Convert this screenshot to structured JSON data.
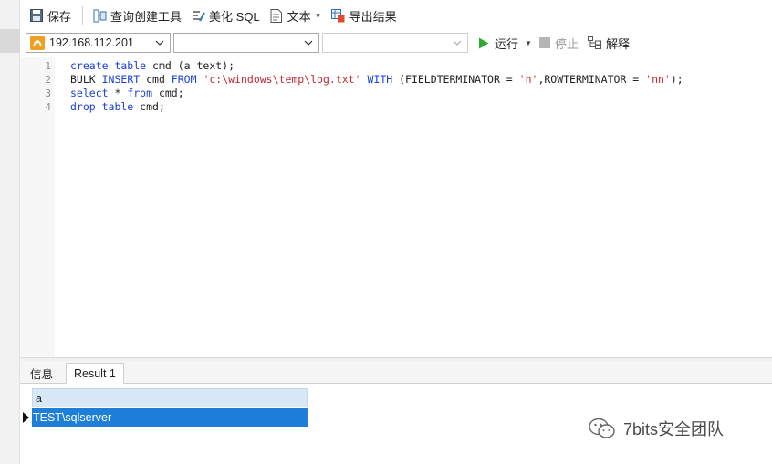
{
  "toolbar": {
    "save": "保存",
    "query_builder": "查询创建工具",
    "beautify_sql": "美化 SQL",
    "text": "文本",
    "export": "导出结果"
  },
  "connection": {
    "server": "192.168.112.201",
    "database": "",
    "schema": "",
    "run": "运行",
    "stop": "停止",
    "explain": "解释"
  },
  "editor": {
    "line_numbers": [
      "1",
      "2",
      "3",
      "4"
    ],
    "lines": [
      [
        {
          "t": "create table",
          "c": "kw"
        },
        {
          "t": " cmd (a text);",
          "c": ""
        }
      ],
      [
        {
          "t": "BULK ",
          "c": ""
        },
        {
          "t": "INSERT",
          "c": "kw"
        },
        {
          "t": " cmd ",
          "c": ""
        },
        {
          "t": "FROM",
          "c": "kw"
        },
        {
          "t": " ",
          "c": ""
        },
        {
          "t": "'c:\\windows\\temp\\log.txt'",
          "c": "str"
        },
        {
          "t": " ",
          "c": ""
        },
        {
          "t": "WITH",
          "c": "kw"
        },
        {
          "t": " (FIELDTERMINATOR = ",
          "c": ""
        },
        {
          "t": "'n'",
          "c": "str"
        },
        {
          "t": ",ROWTERMINATOR = ",
          "c": ""
        },
        {
          "t": "'nn'",
          "c": "str"
        },
        {
          "t": ");",
          "c": ""
        }
      ],
      [
        {
          "t": "select",
          "c": "kw"
        },
        {
          "t": " * ",
          "c": ""
        },
        {
          "t": "from",
          "c": "kw"
        },
        {
          "t": " cmd;",
          "c": ""
        }
      ],
      [
        {
          "t": "drop table",
          "c": "kw"
        },
        {
          "t": " cmd;",
          "c": ""
        }
      ]
    ]
  },
  "results": {
    "tabs": [
      "信息",
      "Result 1"
    ],
    "active_tab": "Result 1",
    "column": "a",
    "rows": [
      "TEST\\sqlserver"
    ]
  },
  "watermark": "7bits安全团队",
  "colors": {
    "keyword": "#1a3fd8",
    "string": "#c2282f",
    "selected_row": "#1e7fd9",
    "header_bg": "#d9e8f7",
    "run_green": "#2eaa2e"
  }
}
